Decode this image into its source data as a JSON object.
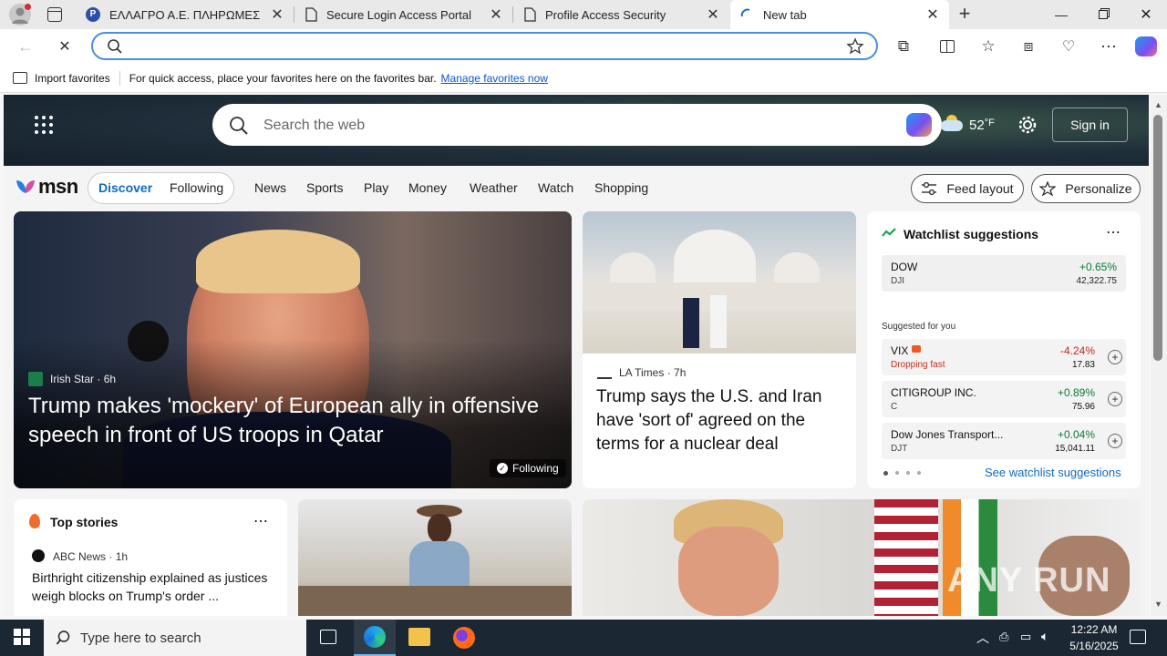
{
  "browser": {
    "tabs": [
      {
        "title": "ΕΛΛΑΓΡΟ Α.Ε. ΠΛΗΡΩΜΕΣ",
        "icon": "pay-icon"
      },
      {
        "title": "Secure Login Access Portal",
        "icon": "document-icon"
      },
      {
        "title": "Profile Access Security",
        "icon": "document-icon"
      },
      {
        "title": "New tab",
        "icon": "loading-icon"
      }
    ],
    "address_value": "",
    "favorites_bar": {
      "import_label": "Import favorites",
      "message": "For quick access, place your favorites here on the favorites bar.",
      "manage_link": "Manage favorites now"
    }
  },
  "msn": {
    "search_placeholder": "Search the web",
    "weather_temp": "52",
    "weather_unit": "°F",
    "sign_in": "Sign in",
    "logo": "msn",
    "feed_tabs": [
      "Discover",
      "Following"
    ],
    "nav": [
      "News",
      "Sports",
      "Play",
      "Money",
      "Weather",
      "Watch",
      "Shopping"
    ],
    "feed_layout": "Feed layout",
    "personalize": "Personalize",
    "hero_story": {
      "source": "Irish Star",
      "age": "6h",
      "headline": "Trump makes 'mockery' of European ally in offensive speech in front of US troops in Qatar",
      "following": "Following"
    },
    "second_story": {
      "source": "LA Times",
      "age": "7h",
      "headline": "Trump says the U.S. and Iran have 'sort of' agreed on the terms for a nuclear deal"
    },
    "watchlist": {
      "title": "Watchlist suggestions",
      "top": {
        "name": "DOW",
        "ticker": "DJI",
        "change": "+0.65%",
        "value": "42,322.75"
      },
      "suggested_label": "Suggested for you",
      "items": [
        {
          "name": "VIX",
          "sub": "Dropping fast",
          "change": "-4.24%",
          "value": "17.83"
        },
        {
          "name": "CITIGROUP INC.",
          "sub": "C",
          "change": "+0.89%",
          "value": "75.96"
        },
        {
          "name": "Dow Jones Transport...",
          "sub": "DJT",
          "change": "+0.04%",
          "value": "15,041.11"
        }
      ],
      "see_more": "See watchlist suggestions"
    },
    "top_stories": {
      "title": "Top stories",
      "source": "ABC News",
      "age": "1h",
      "headline": "Birthright citizenship explained as justices weigh blocks on Trump's order ..."
    },
    "watermark": "ANY RUN"
  },
  "taskbar": {
    "search_placeholder": "Type here to search",
    "time": "12:22 AM",
    "date": "5/16/2025"
  },
  "colors": {
    "accent": "#0f6cbd",
    "positive": "#0d7a35",
    "negative": "#c42b1c"
  }
}
